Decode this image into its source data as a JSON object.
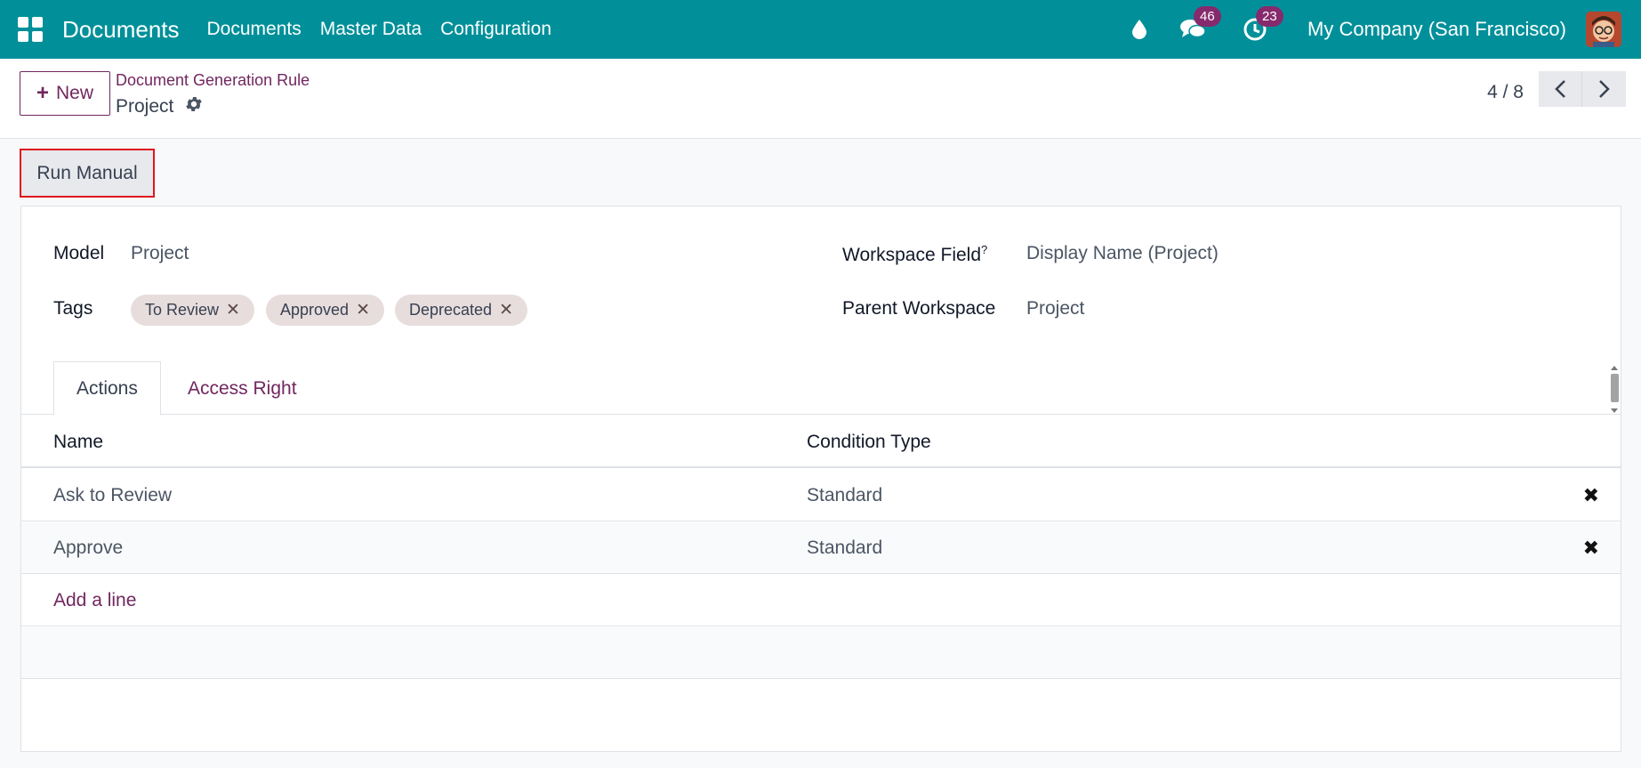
{
  "navbar": {
    "brand": "Documents",
    "menu": [
      "Documents",
      "Master Data",
      "Configuration"
    ],
    "messages_count": "46",
    "activities_count": "23",
    "company": "My Company (San Francisco)"
  },
  "control_panel": {
    "new_label": "New",
    "breadcrumb": "Document Generation Rule",
    "record_title": "Project",
    "pager": "4 / 8"
  },
  "status_bar": {
    "run_manual_label": "Run Manual"
  },
  "form": {
    "model_label": "Model",
    "model_value": "Project",
    "tags_label": "Tags",
    "tags": [
      "To Review",
      "Approved",
      "Deprecated"
    ],
    "workspace_field_label": "Workspace Field",
    "workspace_field_help": "?",
    "workspace_field_value": "Display Name (Project)",
    "parent_workspace_label": "Parent Workspace",
    "parent_workspace_value": "Project"
  },
  "tabs": {
    "actions": "Actions",
    "access_right": "Access Right"
  },
  "actions_table": {
    "headers": [
      "Name",
      "Condition Type"
    ],
    "rows": [
      {
        "name": "Ask to Review",
        "condition_type": "Standard"
      },
      {
        "name": "Approve",
        "condition_type": "Standard"
      }
    ],
    "add_line": "Add a line"
  },
  "colors": {
    "navbar": "#01909a",
    "accent": "#71275f",
    "badge": "#862a6d",
    "highlight_border": "#e0161f"
  }
}
